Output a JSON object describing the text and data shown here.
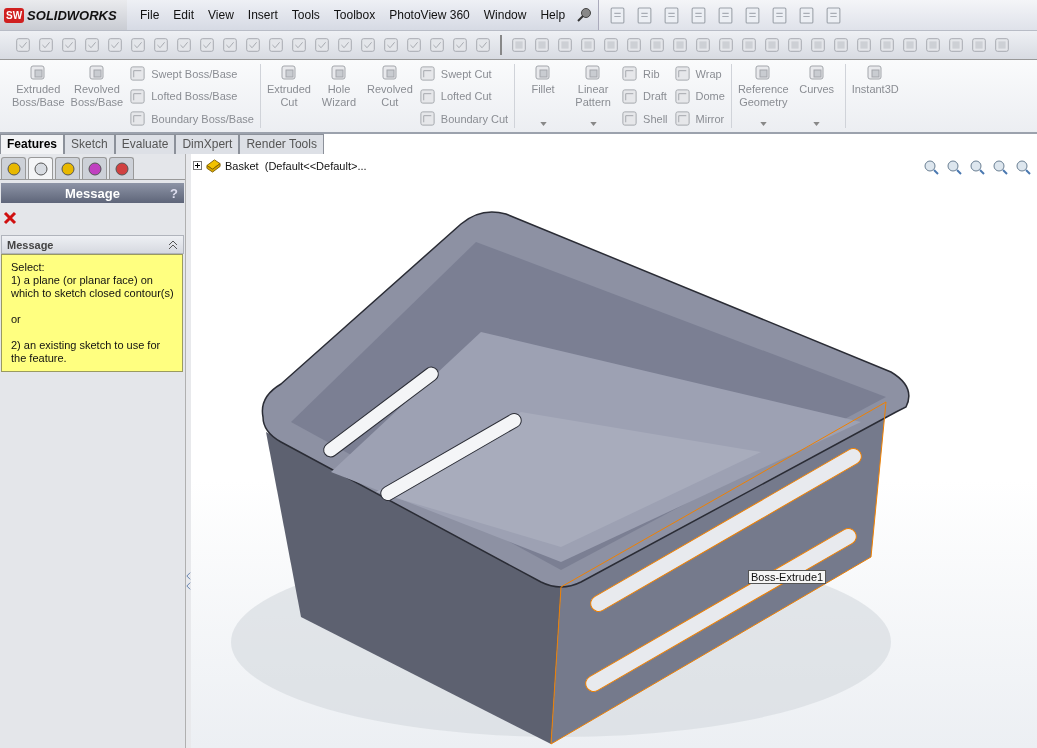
{
  "app": {
    "badge": "SW",
    "logo": "SOLIDWORKS"
  },
  "menu": [
    "File",
    "Edit",
    "View",
    "Insert",
    "Tools",
    "Toolbox",
    "PhotoView 360",
    "Window",
    "Help"
  ],
  "command_manager": [
    [
      {
        "kind": "large",
        "label": "Extruded\nBoss/Base",
        "dropdown": false
      },
      {
        "kind": "large",
        "label": "Revolved\nBoss/Base",
        "dropdown": false
      },
      {
        "kind": "stack",
        "items": [
          "Swept Boss/Base",
          "Lofted Boss/Base",
          "Boundary Boss/Base"
        ]
      }
    ],
    [
      {
        "kind": "large",
        "label": "Extruded\nCut",
        "dropdown": false
      },
      {
        "kind": "large",
        "label": "Hole\nWizard",
        "dropdown": false
      },
      {
        "kind": "large",
        "label": "Revolved\nCut",
        "dropdown": false
      },
      {
        "kind": "stack",
        "items": [
          "Swept Cut",
          "Lofted Cut",
          "Boundary Cut"
        ]
      }
    ],
    [
      {
        "kind": "large",
        "label": "Fillet",
        "dropdown": true
      },
      {
        "kind": "large",
        "label": "Linear\nPattern",
        "dropdown": true
      },
      {
        "kind": "stack",
        "items": [
          "Rib",
          "Draft",
          "Shell"
        ]
      },
      {
        "kind": "stack",
        "items": [
          "Wrap",
          "Dome",
          "Mirror"
        ]
      }
    ],
    [
      {
        "kind": "large",
        "label": "Reference\nGeometry",
        "dropdown": true
      },
      {
        "kind": "large",
        "label": "Curves",
        "dropdown": true
      }
    ],
    [
      {
        "kind": "large",
        "label": "Instant3D",
        "dropdown": false
      }
    ]
  ],
  "tabs": [
    {
      "label": "Features",
      "selected": true
    },
    {
      "label": "Sketch",
      "selected": false
    },
    {
      "label": "Evaluate",
      "selected": false
    },
    {
      "label": "DimXpert",
      "selected": false
    },
    {
      "label": "Render Tools",
      "selected": false
    }
  ],
  "panel_tabs": [
    {
      "selected": false
    },
    {
      "selected": true
    },
    {
      "selected": false
    },
    {
      "selected": false
    },
    {
      "selected": false
    }
  ],
  "property_manager": {
    "title": "Message",
    "help": "?",
    "section": {
      "title": "Message",
      "expanded": true,
      "paragraphs": [
        "Select:\n1) a plane (or planar face) on which to sketch closed contour(s)",
        "or",
        "2) an existing sketch to use for the feature."
      ]
    }
  },
  "tree": {
    "root": "Basket  (Default<<Default>...",
    "expanded": false
  },
  "tooltip": "Boss-Extrude1"
}
